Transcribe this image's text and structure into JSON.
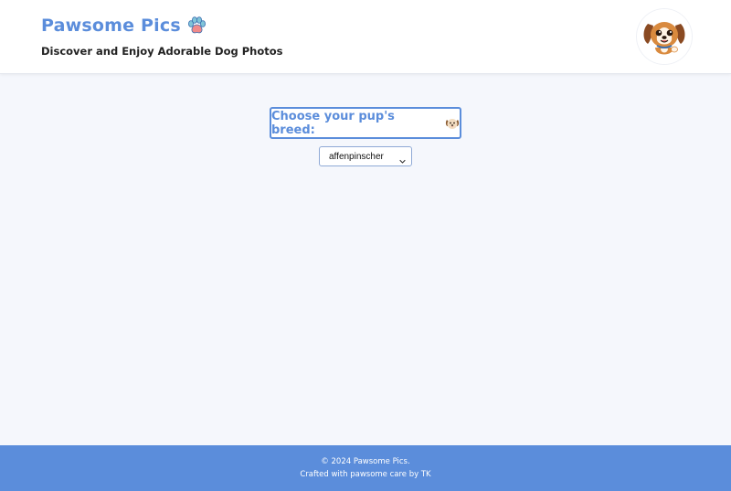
{
  "header": {
    "title": "Pawsome Pics",
    "title_icon": "paw-icon",
    "tagline": "Discover and Enjoy Adorable Dog Photos",
    "avatar_icon": "cartoon-dog-avatar"
  },
  "main": {
    "breed_prompt": "Choose your pup's breed:",
    "breed_prompt_icon": "dog-face-emoji",
    "breed_select": {
      "selected": "affenpinscher"
    }
  },
  "footer": {
    "copyright": "© 2024 Pawsome Pics.",
    "credit": "Crafted with pawsome care by TK"
  },
  "colors": {
    "accent": "#5b8ddb",
    "background": "#f5f7fc",
    "header_bg": "#ffffff"
  }
}
